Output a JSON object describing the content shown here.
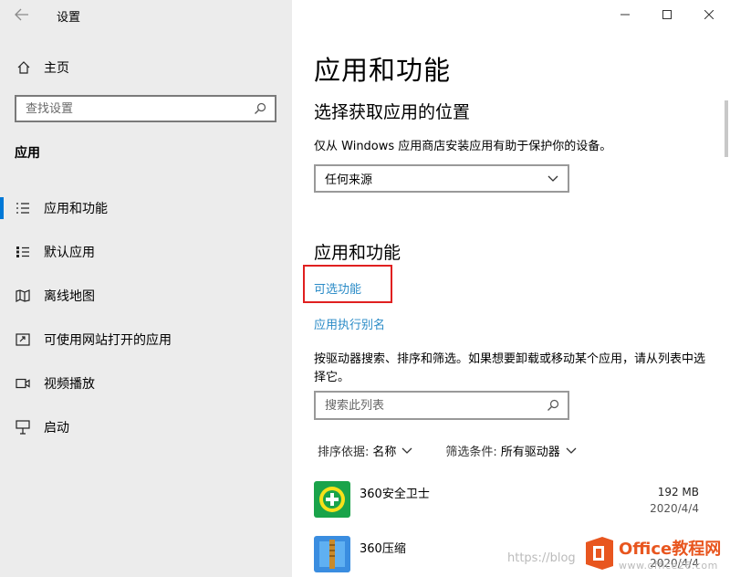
{
  "window": {
    "title": "设置"
  },
  "sidebar": {
    "home_label": "主页",
    "search_placeholder": "查找设置",
    "section_title": "应用",
    "items": [
      {
        "label": "应用和功能",
        "icon": "apps-features-icon",
        "active": true
      },
      {
        "label": "默认应用",
        "icon": "default-apps-icon",
        "active": false
      },
      {
        "label": "离线地图",
        "icon": "offline-maps-icon",
        "active": false
      },
      {
        "label": "可使用网站打开的应用",
        "icon": "apps-for-websites-icon",
        "active": false
      },
      {
        "label": "视频播放",
        "icon": "video-playback-icon",
        "active": false
      },
      {
        "label": "启动",
        "icon": "startup-icon",
        "active": false
      }
    ]
  },
  "main": {
    "page_title": "应用和功能",
    "install_heading": "选择获取应用的位置",
    "install_desc": "仅从 Windows 应用商店安装应用有助于保护你的设备。",
    "source_dropdown_value": "任何来源",
    "features_heading": "应用和功能",
    "optional_features_link": "可选功能",
    "app_alias_link": "应用执行别名",
    "list_desc": "按驱动器搜索、排序和筛选。如果想要卸载或移动某个应用，请从列表中选择它。",
    "list_search_placeholder": "搜索此列表",
    "sort_label": "排序依据:",
    "sort_value": "名称",
    "filter_label": "筛选条件:",
    "filter_value": "所有驱动器",
    "apps": [
      {
        "name": "360安全卫士",
        "size": "192 MB",
        "date": "2020/4/4"
      },
      {
        "name": "360压缩",
        "size": "",
        "date": "2020/4/4"
      }
    ]
  },
  "watermark": {
    "url": "https://blog",
    "brand": "Office教程网",
    "site": "www.office26.com"
  },
  "colors": {
    "accent": "#0078d7",
    "link": "#2a8bc7",
    "highlight": "#e02020",
    "sidebar_bg": "#ececec"
  }
}
